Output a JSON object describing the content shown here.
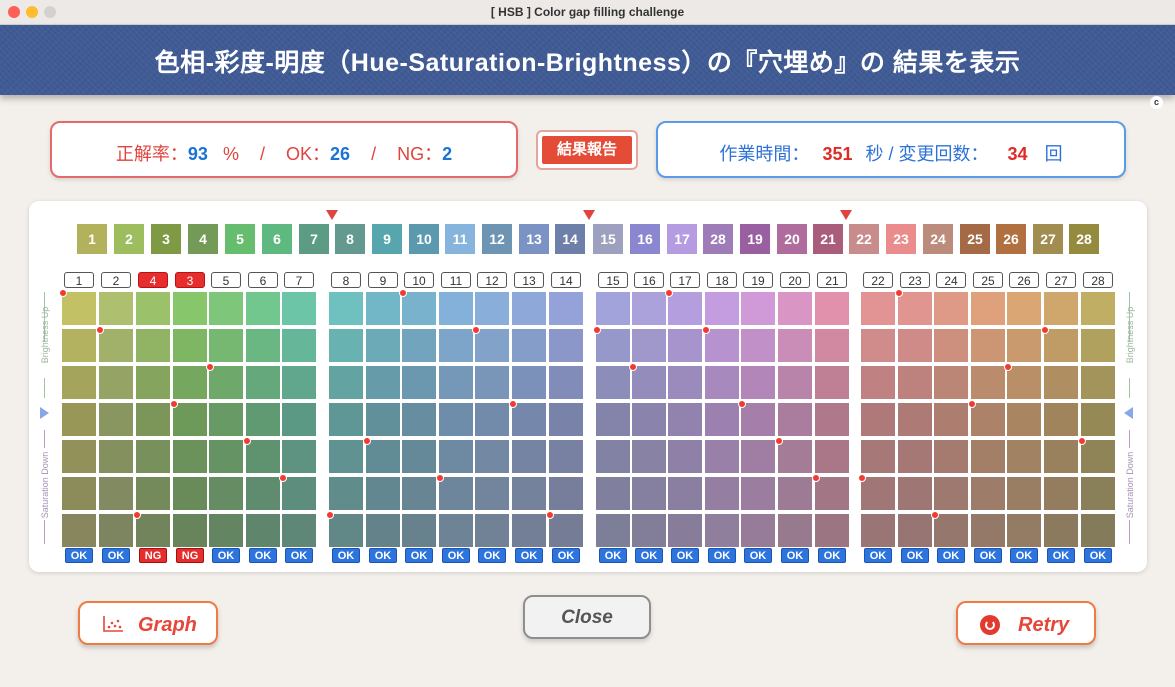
{
  "window": {
    "title": "[ HSB ] Color gap filling challenge"
  },
  "header": {
    "title": "色相-彩度-明度（Hue-Saturation-Brightness）の『穴埋め』の 結果を表示",
    "copyright": "c"
  },
  "score": {
    "rate_label": "正解率：",
    "rate_value": "93",
    "rate_unit": "%",
    "sep1": "/",
    "ok_label": "OK：",
    "ok_value": "26",
    "sep2": "/",
    "ng_label": "NG：",
    "ng_value": "2"
  },
  "report_button": "結果報告",
  "time": {
    "time_label": "作業時間：",
    "time_value": "351",
    "time_unit": "秒 / 変更回数：",
    "count_value": "34",
    "count_unit": "回"
  },
  "targets": [
    "1",
    "2",
    "3",
    "4",
    "5",
    "6",
    "7",
    "8",
    "9",
    "10",
    "11",
    "12",
    "13",
    "14",
    "15",
    "16",
    "17",
    "28",
    "19",
    "20",
    "21",
    "22",
    "23",
    "24",
    "25",
    "26",
    "27",
    "28"
  ],
  "target_colors": [
    "#b2b25c",
    "#9dbd5e",
    "#7f9a45",
    "#739a56",
    "#66bd6d",
    "#5db980",
    "#5c9b84",
    "#63998f",
    "#57a6ad",
    "#5b9aae",
    "#86b4dc",
    "#6e94b4",
    "#7b92c4",
    "#6e7fa9",
    "#9da0be",
    "#8a86cf",
    "#b59bdf",
    "#9e7cb7",
    "#9a5fa0",
    "#af6c9c",
    "#a95d7a",
    "#c98c8c",
    "#eb8c8c",
    "#bb8b7b",
    "#a36a45",
    "#b0703f",
    "#a18d4f",
    "#958b3e"
  ],
  "column_labels": [
    "1",
    "2",
    "4",
    "3",
    "5",
    "6",
    "7",
    "8",
    "9",
    "10",
    "11",
    "12",
    "13",
    "14",
    "15",
    "16",
    "17",
    "18",
    "19",
    "20",
    "21",
    "22",
    "23",
    "24",
    "25",
    "26",
    "27",
    "28"
  ],
  "ng_label_columns": [
    2,
    3
  ],
  "results": [
    "OK",
    "OK",
    "NG",
    "NG",
    "OK",
    "OK",
    "OK",
    "OK",
    "OK",
    "OK",
    "OK",
    "OK",
    "OK",
    "OK",
    "OK",
    "OK",
    "OK",
    "OK",
    "OK",
    "OK",
    "OK",
    "OK",
    "OK",
    "OK",
    "OK",
    "OK",
    "OK",
    "OK"
  ],
  "grid_rows": 7,
  "selected_rows": [
    0,
    1,
    6,
    3,
    2,
    4,
    5,
    6,
    4,
    0,
    5,
    1,
    3,
    6,
    1,
    2,
    0,
    1,
    3,
    4,
    5,
    5,
    0,
    6,
    3,
    2,
    1,
    4
  ],
  "base_colors": [
    "#c2c166",
    "#aec070",
    "#9bc26a",
    "#87c66a",
    "#7ec77a",
    "#72c78e",
    "#6cc5a6",
    "#6fc1c0",
    "#72b7c7",
    "#79b2cd",
    "#84b1da",
    "#8aaeda",
    "#8ea8da",
    "#94a2d9",
    "#a2a3db",
    "#aba2dc",
    "#b49ede",
    "#c49ce0",
    "#d099d8",
    "#d996c5",
    "#e291ad",
    "#e29494",
    "#e09590",
    "#df9a87",
    "#dea17c",
    "#daa674",
    "#cfa76c",
    "#bfae64"
  ],
  "row_shades": [
    1.0,
    0.93,
    0.86,
    0.8,
    0.78,
    0.76,
    0.74
  ],
  "row_desat": [
    0.0,
    0.04,
    0.08,
    0.14,
    0.22,
    0.3,
    0.38
  ],
  "markers_after_columns": [
    7,
    14,
    21
  ],
  "side_left": {
    "up": "Brightness Up",
    "down": "Saturation Down"
  },
  "side_right": {
    "up": "Brightness Up",
    "down": "Saturation Down"
  },
  "buttons": {
    "graph": "Graph",
    "close": "Close",
    "retry": "Retry"
  }
}
